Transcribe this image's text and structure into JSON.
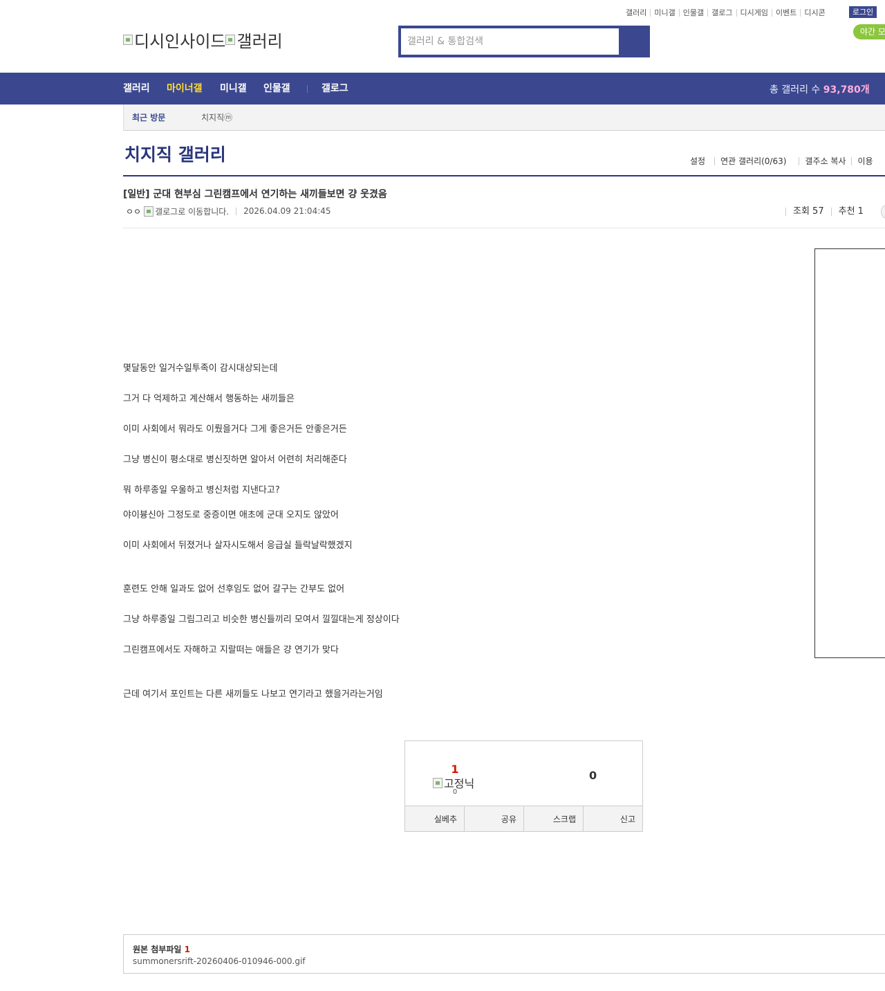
{
  "top_links": [
    "갤러리",
    "미니갤",
    "인물갤",
    "갤로그",
    "디시게임",
    "이벤트",
    "디시콘"
  ],
  "login_label": "로그인",
  "night_mode_label": "야간 모드",
  "logo": {
    "site_alt": "디시인사이드",
    "gallery_alt": "갤러리"
  },
  "search": {
    "placeholder": "갤러리 & 통합검색",
    "value": "",
    "icon": "search-icon"
  },
  "nav": {
    "items": [
      {
        "label": "갤러리",
        "active": false
      },
      {
        "label": "마이너갤",
        "active": true
      },
      {
        "label": "미니갤",
        "active": false
      },
      {
        "label": "인물갤",
        "active": false
      },
      {
        "label": "갤로그",
        "active": false
      }
    ],
    "total_label": "총 갤러리 수",
    "total_count": "93,780개"
  },
  "recent": {
    "label": "최근 방문",
    "items": [
      "치지직ⓜ"
    ]
  },
  "gallery": {
    "title": "치지직 갤러리",
    "tools": [
      "설정",
      "연관 갤러리(0/63)",
      "갤주소 복사",
      "이용"
    ]
  },
  "post": {
    "title": "[일반] 군대 현부심 그린캠프에서 연기하는 새끼들보면 걍 웃겼음",
    "nick": "ㅇㅇ",
    "gallog_alt": "갤로그로 이동합니다.",
    "date": "2026.04.09 21:04:45",
    "views": "조회 57",
    "recommend": "추천 1",
    "body": [
      "몇달동안 일거수일투족이 감시대상되는데",
      "그거 다 억제하고 계산해서 행동하는 새끼들은",
      "이미 사회에서 뭐라도 이뤘을거다 그게 좋은거든 안좋은거든",
      "그냥 병신이 평소대로 병신짓하면 알아서 어련히 처리해준다",
      "뭐 하루종일 우울하고 병신처럼 지낸다고?",
      "야이븅신아 그정도로 중증이면 애초에 군대 오지도 않았어",
      "이미 사회에서 뒤졌거나 살자시도해서 응급실 들락날락했겠지",
      "훈련도 안해 일과도 없어 선후임도 없어 갈구는 간부도 없어",
      "그냥 하루종일 그림그리고 비슷한 병신들끼리 모여서 낄낄대는게 정상이다",
      "그린캠프에서도 자해하고 지랄떠는 애들은 걍 연기가 맞다",
      "근데 여기서 포인트는 다른 새끼들도 나보고 연기라고 했을거라는거임"
    ]
  },
  "recommend_box": {
    "up_count": "1",
    "fixed_nick_alt": "고정닉",
    "fixed_count": "0",
    "down_count": "0",
    "buttons": [
      "실베추",
      "공유",
      "스크랩",
      "신고"
    ]
  },
  "attachment": {
    "label": "원본 첨부파일",
    "count": "1",
    "file": "summonersrift-20260406-010946-000.gif"
  }
}
